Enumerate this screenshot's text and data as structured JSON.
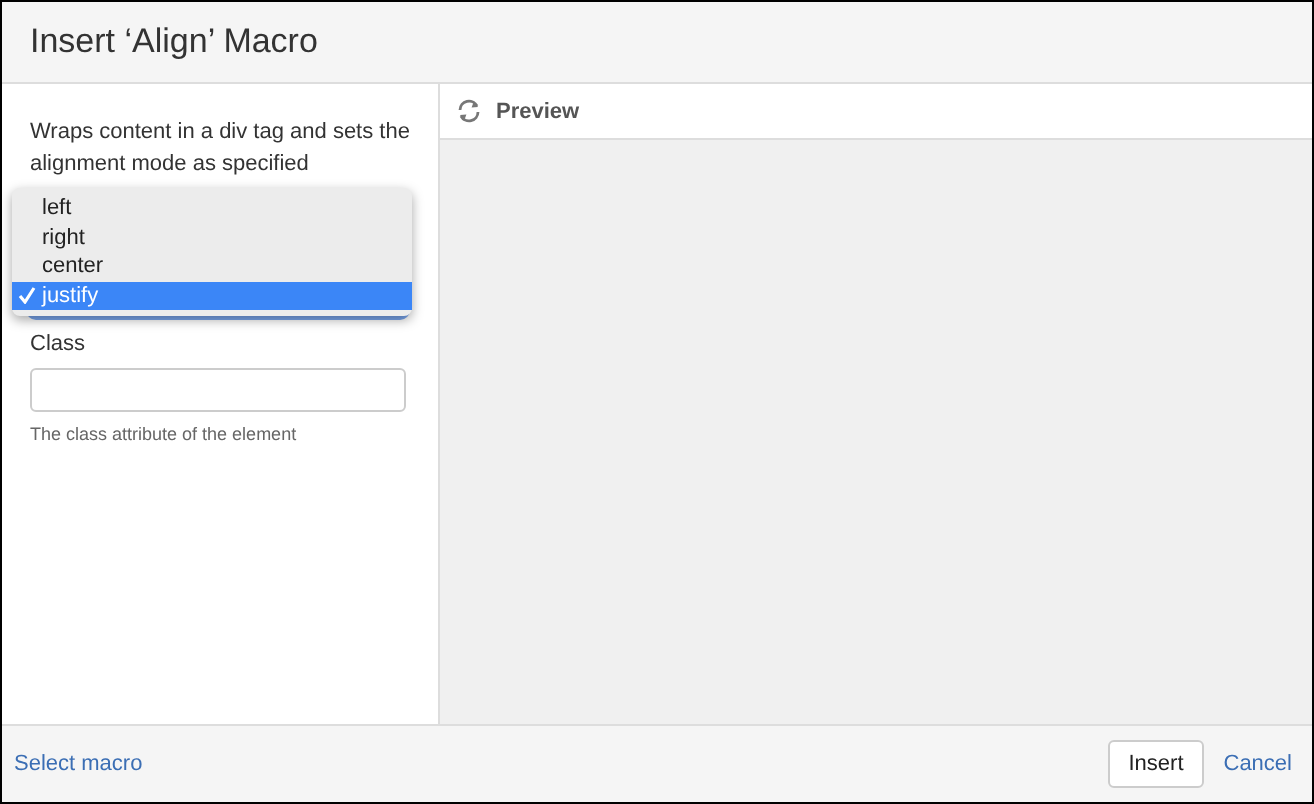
{
  "dialog": {
    "title": "Insert ‘Align’ Macro"
  },
  "description": "Wraps content in a div tag and sets the alignment mode as specified",
  "alignment_menu": {
    "options": [
      {
        "label": "left",
        "selected": false
      },
      {
        "label": "right",
        "selected": false
      },
      {
        "label": "center",
        "selected": false
      },
      {
        "label": "justify",
        "selected": true
      }
    ]
  },
  "class_field": {
    "label": "Class",
    "hint": "The class attribute of the element"
  },
  "preview": {
    "title": "Preview"
  },
  "footer": {
    "link": "Select macro",
    "buttons": [
      {
        "label": "Insert",
        "kind": "button"
      },
      {
        "label": "Cancel",
        "kind": "link"
      }
    ]
  }
}
